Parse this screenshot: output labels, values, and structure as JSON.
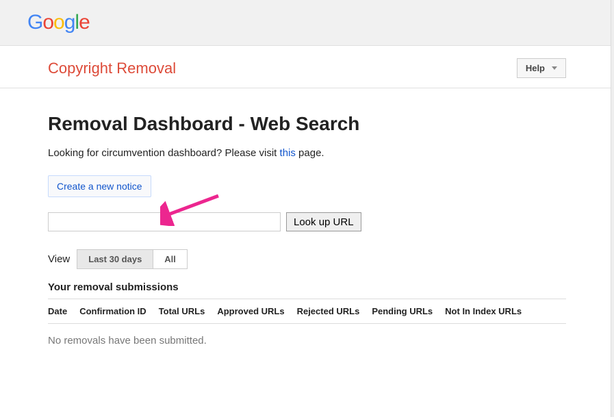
{
  "logo": {
    "g1": "G",
    "o1": "o",
    "o2": "o",
    "g2": "g",
    "l": "l",
    "e": "e"
  },
  "header": {
    "section_title": "Copyright Removal",
    "help_label": "Help"
  },
  "page": {
    "title": "Removal Dashboard - Web Search",
    "subtext_before": "Looking for circumvention dashboard? Please visit ",
    "subtext_link": "this",
    "subtext_after": " page.",
    "create_notice_label": "Create a new notice",
    "lookup_btn_label": "Look up URL",
    "url_input_value": ""
  },
  "view": {
    "label": "View",
    "tab_last30": "Last 30 days",
    "tab_all": "All"
  },
  "submissions": {
    "title": "Your removal submissions",
    "columns": {
      "date": "Date",
      "confirmation_id": "Confirmation ID",
      "total_urls": "Total URLs",
      "approved_urls": "Approved URLs",
      "rejected_urls": "Rejected URLs",
      "pending_urls": "Pending URLs",
      "not_in_index": "Not In Index URLs"
    },
    "empty_message": "No removals have been submitted."
  }
}
